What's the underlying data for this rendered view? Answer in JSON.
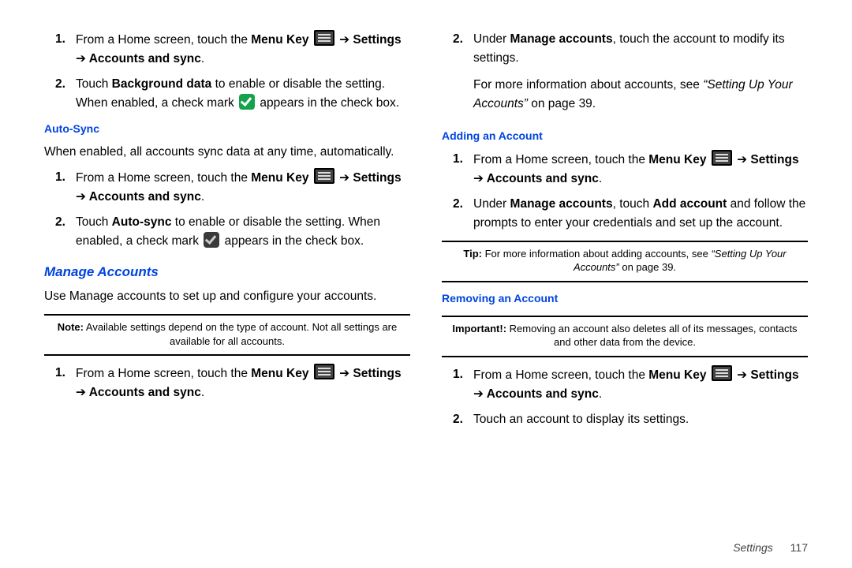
{
  "common": {
    "menu_key_label": "Menu Key",
    "arrow": "➔",
    "settings": "Settings",
    "accounts_sync": "Accounts and sync"
  },
  "left": {
    "steps_top": {
      "n1": "1.",
      "s1a": "From a Home screen, touch the ",
      "s1b": " ",
      "n2": "2.",
      "s2a": "Touch ",
      "s2b": "Background data",
      "s2c": " to enable or disable the setting. When enabled, a check mark ",
      "s2d": " appears in the check box."
    },
    "auto_sync": {
      "h": "Auto-Sync",
      "intro": "When enabled, all accounts sync data at any time, automatically.",
      "n1": "1.",
      "s1a": "From a Home screen, touch the ",
      "n2": "2.",
      "s2a": "Touch ",
      "s2b": "Auto-sync",
      "s2c": " to enable or disable the setting. When enabled, a check mark ",
      "s2d": " appears in the check box."
    },
    "manage": {
      "h": "Manage Accounts",
      "intro": "Use Manage accounts to set up and configure your accounts.",
      "note_label": "Note:",
      "note_body": " Available settings depend on the type of account. Not all settings are available for all accounts.",
      "n1": "1.",
      "s1a": "From a Home screen, touch the "
    }
  },
  "right": {
    "cont": {
      "n2": "2.",
      "s2a": "Under ",
      "s2b": "Manage accounts",
      "s2c": ", touch the account to modify its settings.",
      "more_a": "For more information about accounts, see ",
      "more_b": "“Setting Up Your Accounts”",
      "more_c": " on page 39."
    },
    "adding": {
      "h": "Adding an Account",
      "n1": "1.",
      "s1a": "From a Home screen, touch the ",
      "n2": "2.",
      "s2a": "Under ",
      "s2b": "Manage accounts",
      "s2c": ", touch ",
      "s2d": "Add account",
      "s2e": " and follow the prompts to enter your credentials and set up the account.",
      "tip_label": "Tip:",
      "tip_a": " For more information about adding accounts, see ",
      "tip_b": "“Setting Up Your Accounts”",
      "tip_c": " on page 39."
    },
    "removing": {
      "h": "Removing an Account",
      "imp_label": "Important!:",
      "imp_body": " Removing an account also deletes all of its messages, contacts and other data from the device.",
      "n1": "1.",
      "s1a": "From a Home screen, touch the ",
      "n2": "2.",
      "s2": "Touch an account to display its settings."
    }
  },
  "footer": {
    "section": "Settings",
    "page": "117"
  }
}
